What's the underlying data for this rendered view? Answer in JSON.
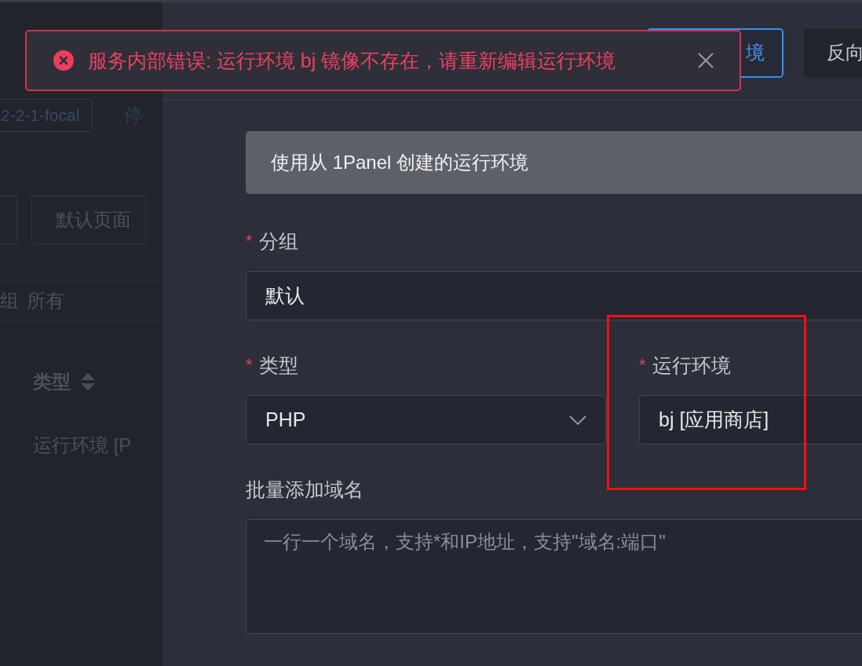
{
  "background_page": {
    "tag": "2-2-1-focal",
    "tag_cut": "停",
    "button": "默认页面",
    "filter_label": "组",
    "filter_value": "所有",
    "column_header": "类型",
    "row_cell": "运行环境 [P"
  },
  "toolbar_buttons": [
    {
      "label": "境",
      "primary": true
    },
    {
      "label": "反向",
      "primary": false
    }
  ],
  "toast": {
    "kind": "error",
    "message": "服务内部错误: 运行环境 bj 镜像不存在，请重新编辑运行环境"
  },
  "form": {
    "section_title": "使用从 1Panel 创建的运行环境",
    "rows": [
      [
        {
          "kind": "input",
          "label": "分组",
          "required_mark": "*",
          "value": "默认"
        }
      ],
      [
        {
          "kind": "select",
          "label": "类型",
          "required_mark": "*",
          "value": "PHP"
        },
        {
          "kind": "input",
          "label": "运行环境",
          "required_mark": "*",
          "value": "bj [应用商店]",
          "highlighted": true
        }
      ],
      [
        {
          "kind": "textarea",
          "label": "批量添加域名",
          "placeholder": "一行一个域名，支持*和IP地址，支持\"域名:端口\""
        }
      ]
    ]
  }
}
